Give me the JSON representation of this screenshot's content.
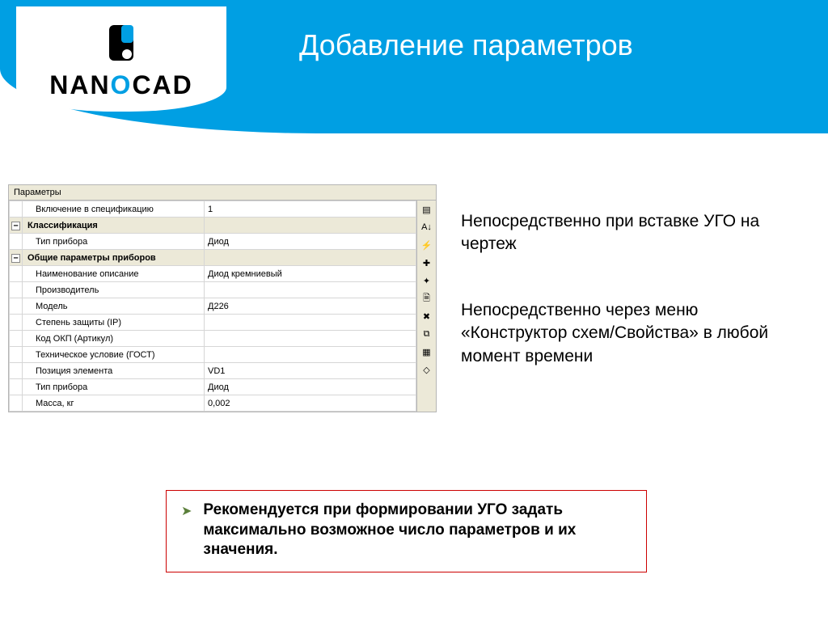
{
  "slide": {
    "title": "Добавление параметров",
    "brand": {
      "name": "NANOCAD"
    }
  },
  "panel": {
    "title": "Параметры",
    "rows": [
      {
        "type": "indent",
        "name": "Включение в спецификацию",
        "value": "1"
      },
      {
        "type": "group",
        "name": "Классификация",
        "value": ""
      },
      {
        "type": "indent",
        "name": "Тип прибора",
        "value": "Диод"
      },
      {
        "type": "group",
        "name": "Общие параметры приборов",
        "value": ""
      },
      {
        "type": "indent",
        "name": "Наименование описание",
        "value": "Диод кремниевый"
      },
      {
        "type": "indent",
        "name": "Производитель",
        "value": ""
      },
      {
        "type": "indent",
        "name": "Модель",
        "value": "Д226"
      },
      {
        "type": "indent",
        "name": "Степень защиты (IP)",
        "value": ""
      },
      {
        "type": "indent",
        "name": "Код ОКП (Артикул)",
        "value": ""
      },
      {
        "type": "indent",
        "name": "Техническое условие (ГОСТ)",
        "value": ""
      },
      {
        "type": "indent",
        "name": "Позиция элемента",
        "value": "VD1"
      },
      {
        "type": "indent",
        "name": "Тип прибора",
        "value": "Диод"
      },
      {
        "type": "indent",
        "name": "Масса, кг",
        "value": "0,002"
      }
    ],
    "toolbar": [
      {
        "id": "categorize",
        "glyph": "▤"
      },
      {
        "id": "sort-az",
        "glyph": "A↓"
      },
      {
        "id": "filter",
        "glyph": "⚡"
      },
      {
        "id": "add",
        "glyph": "✚"
      },
      {
        "id": "spark",
        "glyph": "✦"
      },
      {
        "id": "props",
        "glyph": "🗎"
      },
      {
        "id": "delete",
        "glyph": "✖"
      },
      {
        "id": "copy",
        "glyph": "⧉"
      },
      {
        "id": "apply",
        "glyph": "▦"
      },
      {
        "id": "clear",
        "glyph": "◇"
      }
    ]
  },
  "notes": {
    "p1": "Непосредственно при вставке УГО на чертеж",
    "p2": "Непосредственно через меню «Конструктор схем/Свойства» в любой момент времени"
  },
  "recommendation": {
    "bullet": "➤",
    "text": "Рекомендуется при формировании УГО задать максимально возможное число параметров и их значения."
  }
}
